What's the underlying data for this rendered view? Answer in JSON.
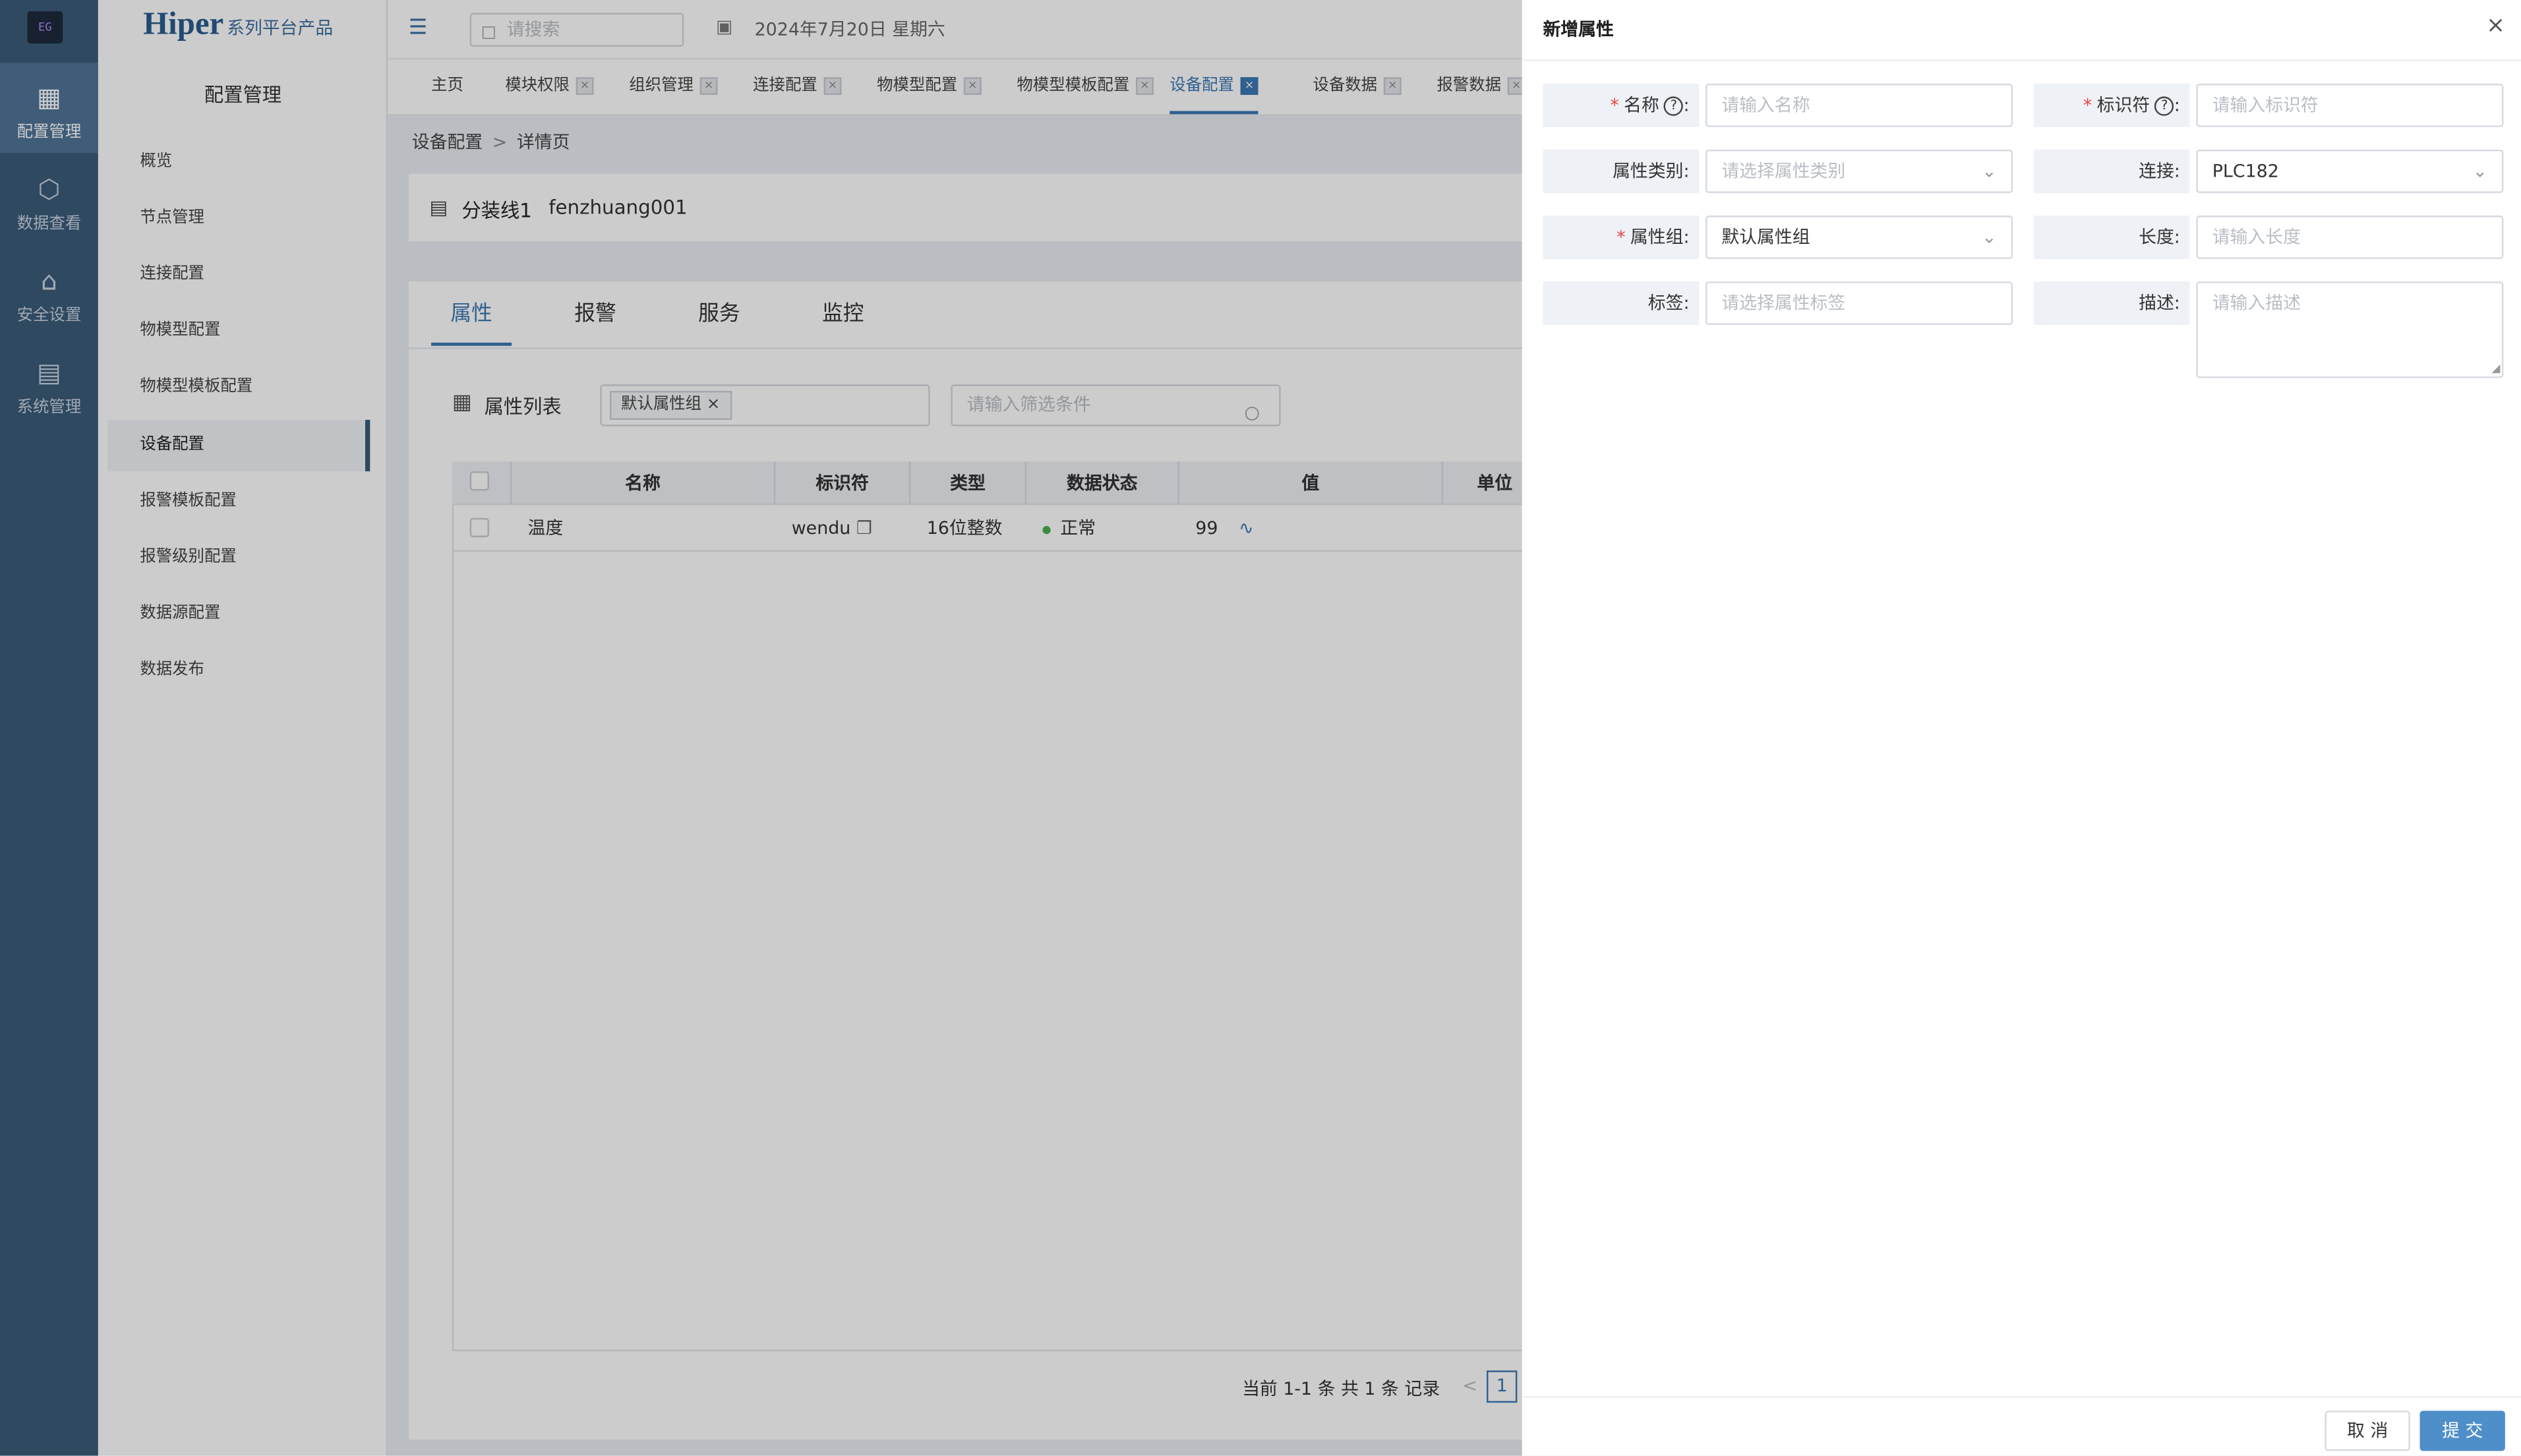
{
  "colors": {
    "rail_bg": "#3a5c79",
    "accent": "#3b78b4",
    "required": "#e34848",
    "submit_bg": "#4e8ec9",
    "status_ok": "#4caf50"
  },
  "rail": {
    "logo": "EG",
    "items": [
      {
        "label": "配置管理",
        "icon": "drafting-icon"
      },
      {
        "label": "数据查看",
        "icon": "cube-icon"
      },
      {
        "label": "安全设置",
        "icon": "shield-house-icon"
      },
      {
        "label": "系统管理",
        "icon": "system-settings-icon"
      }
    ]
  },
  "brand": {
    "name": "Hiper",
    "suffix": "系列平台产品"
  },
  "subnav": {
    "title": "配置管理",
    "items": [
      "概览",
      "节点管理",
      "连接配置",
      "物模型配置",
      "物模型模板配置",
      "设备配置",
      "报警模板配置",
      "报警级别配置",
      "数据源配置",
      "数据发布"
    ],
    "active": "设备配置"
  },
  "topbar": {
    "search_placeholder": "请搜索",
    "date": "2024年7月20日 星期六"
  },
  "page_tabs": [
    "主页",
    "模块权限",
    "组织管理",
    "连接配置",
    "物模型配置",
    "物模型模板配置",
    "设备配置",
    "设备数据",
    "报警数据"
  ],
  "breadcrumb": {
    "root": "设备配置",
    "sep": ">",
    "current": "详情页"
  },
  "device": {
    "name": "分装线1",
    "code": "fenzhuang001"
  },
  "detail_tabs": [
    "属性",
    "报警",
    "服务",
    "监控"
  ],
  "prop_list": {
    "title": "属性列表",
    "group_chip": "默认属性组",
    "filter_placeholder": "请输入筛选条件",
    "columns": [
      "名称",
      "标识符",
      "类型",
      "数据状态",
      "值",
      "单位"
    ],
    "rows": [
      {
        "name": "温度",
        "identifier": "wendu",
        "type": "16位整数",
        "status": "正常",
        "value": "99"
      }
    ],
    "pager_text": "当前 1-1 条 共 1 条 记录",
    "pager_prev": "<",
    "pager_page": "1"
  },
  "drawer": {
    "title": "新增属性",
    "close": "×",
    "fields": {
      "name": {
        "label": "名称",
        "colon": ":",
        "help": "?",
        "placeholder": "请输入名称"
      },
      "identifier": {
        "label": "标识符",
        "colon": ":",
        "help": "?",
        "placeholder": "请输入标识符"
      },
      "category": {
        "label": "属性类别:",
        "placeholder": "请选择属性类别"
      },
      "connection": {
        "label": "连接:",
        "value": "PLC182"
      },
      "group": {
        "label": "属性组:",
        "value": "默认属性组"
      },
      "length": {
        "label": "长度:",
        "placeholder": "请输入长度"
      },
      "tags": {
        "label": "标签:",
        "placeholder": "请选择属性标签"
      },
      "description": {
        "label": "描述:",
        "placeholder": "请输入描述"
      }
    },
    "required_mark": "*",
    "cancel": "取 消",
    "submit": "提 交"
  }
}
